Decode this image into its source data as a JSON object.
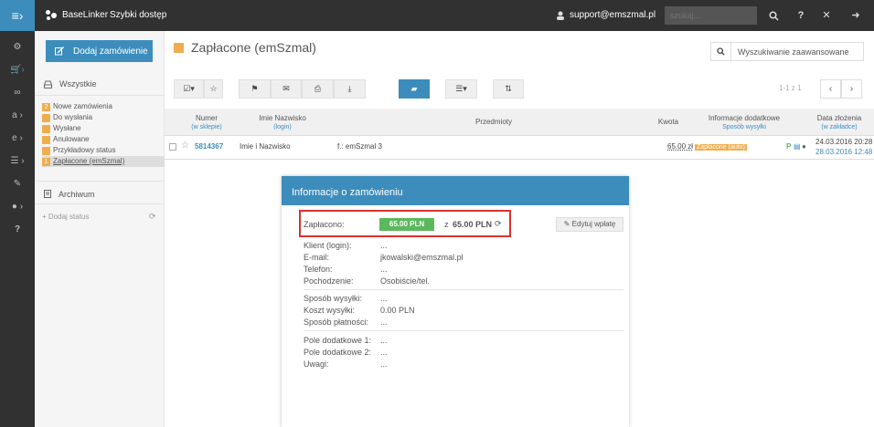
{
  "topbar": {
    "menu_icon": "≡›",
    "brand": "BaseLinker",
    "quick_access": "Szybki dostęp",
    "user_email": "support@emszmal.pl",
    "search_placeholder": "szukaj...",
    "icons": [
      "search-icon",
      "help-icon",
      "fullscreen-icon",
      "logout-icon"
    ]
  },
  "rail": {
    "icons": [
      "dashboard-icon",
      "cart-icon",
      "link-icon",
      "amazon-icon",
      "ebay-icon",
      "database-icon",
      "wrench-icon",
      "user-icon",
      "help-icon"
    ]
  },
  "sidebar": {
    "add_order": "Dodaj zamówienie",
    "all": "Wszystkie",
    "statuses": [
      {
        "count": "2",
        "label": "Nowe zamówienia"
      },
      {
        "count": "",
        "label": "Do wysłania"
      },
      {
        "count": "",
        "label": "Wysłane"
      },
      {
        "count": "",
        "label": "Anulowane"
      },
      {
        "count": "",
        "label": "Przykładowy status"
      },
      {
        "count": "1",
        "label": "Zapłacone (emSzmal)"
      }
    ],
    "archive": "Archiwum",
    "add_status": "+ Dodaj status"
  },
  "main": {
    "title": "Zapłacone (emSzmal)",
    "advanced_search": "Wyszukiwanie zaawansowane",
    "pagination": "1-1 z 1"
  },
  "table": {
    "headers": {
      "number": "Numer",
      "number_sub": "(w sklepie)",
      "name": "Imie Nazwisko",
      "name_sub": "(login)",
      "items": "Przedmioty",
      "amount": "Kwota",
      "info": "Informacje dodatkowe",
      "info_sub": "Sposób wysyłki",
      "date": "Data złożenia",
      "date_sub": "(w zakładce)"
    },
    "row": {
      "number": "5814367",
      "name": "Imie i Nazwisko",
      "items": "f.: emSzmal 3",
      "amount": "65.00 zł",
      "status_badge": "Zapłacone (auto)",
      "info_flag": "P",
      "date": "24.03.2016 20:28",
      "date_sub": "28.03.2016 12:48"
    }
  },
  "popup": {
    "title": "Informacje o zamówieniu",
    "paid_label": "Zapłacono:",
    "paid_amount": "65.00 PLN",
    "paid_of_prefix": "z",
    "paid_of": "65.00 PLN",
    "edit_payment": "Edytuj wpłatę",
    "client_label": "Klient (login):",
    "client_value": "...",
    "email_label": "E-mail:",
    "email_value": "jkowalski@emszmal.pl",
    "phone_label": "Telefon:",
    "phone_value": "...",
    "origin_label": "Pochodzenie:",
    "origin_value": "Osobiście/tel.",
    "shipping_label": "Sposób wysyłki:",
    "shipping_value": "...",
    "shipping_cost_label": "Koszt wysyłki:",
    "shipping_cost_value": "0.00 PLN",
    "payment_label": "Sposób płatności:",
    "payment_value": "...",
    "extra1_label": "Pole dodatkowe 1:",
    "extra1_value": "...",
    "extra2_label": "Pole dodatkowe 2:",
    "extra2_value": "...",
    "notes_label": "Uwagi:",
    "notes_value": "..."
  },
  "colors": {
    "accent": "#3c8dbc",
    "status_orange": "#f0ad4e",
    "paid_green": "#5cb85c",
    "highlight_red": "#d9322e",
    "dark_bar": "#313131"
  }
}
